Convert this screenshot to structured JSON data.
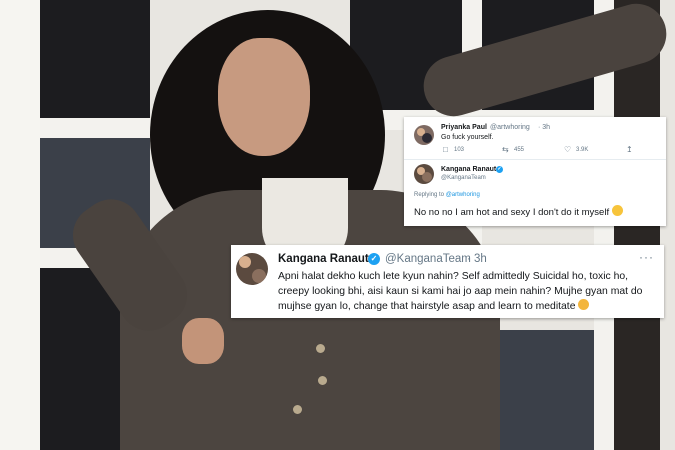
{
  "tweet_reply": {
    "author_name": "Priyanka Paul",
    "author_handle": "@artwhoring",
    "time": "· 3h",
    "text": "Go fuck yourself.",
    "stats": {
      "replies": "103",
      "retweets": "455",
      "likes": "3.9K"
    },
    "reply_author_name": "Kangana Ranaut",
    "reply_author_handle": "@KanganaTeam",
    "replying_to_label": "Replying to",
    "replying_to_handle": "@artwhoring",
    "reply_text": "No no no I am hot and sexy I don't do it myself"
  },
  "tweet_main": {
    "author_name": "Kangana Ranaut",
    "author_handle": "@KanganaTeam",
    "time": "· 3h",
    "more": "···",
    "text": "Apni halat dekho kuch lete kyun nahin? Self admittedly Suicidal ho, toxic ho, creepy looking bhi, aisi kaun si kami hai jo aap mein nahin? Mujhe gyan mat do mujhse gyan lo, change that hairstyle asap and learn to meditate"
  },
  "icons": {
    "verified": "verified-badge-icon",
    "reply": "reply-icon",
    "retweet": "retweet-icon",
    "like": "heart-icon",
    "share": "share-icon",
    "emoji_reply": "upside-down-face-emoji",
    "emoji_main": "folded-hands-emoji"
  },
  "colors": {
    "twitter_blue": "#1da1f2",
    "text": "#14171a",
    "muted": "#657786",
    "card": "#ffffff"
  }
}
